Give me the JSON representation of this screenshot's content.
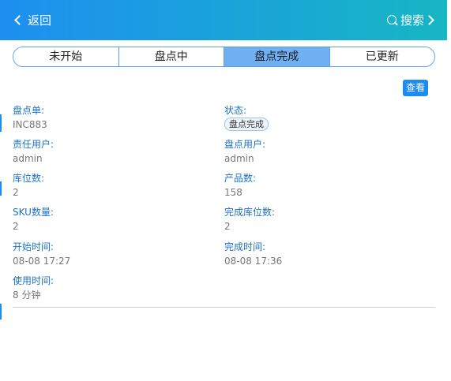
{
  "header": {
    "back_label": "返回",
    "search_label": "搜索"
  },
  "tabs": [
    {
      "label": "未开始",
      "active": false
    },
    {
      "label": "盘点中",
      "active": false
    },
    {
      "label": "盘点完成",
      "active": true
    },
    {
      "label": "已更新",
      "active": false
    }
  ],
  "view_button": "查看",
  "fields": {
    "order": {
      "label": "盘点单:",
      "value": "INC883"
    },
    "status": {
      "label": "状态:",
      "value": "盘点完成"
    },
    "owner": {
      "label": "责任用户:",
      "value": "admin"
    },
    "counter": {
      "label": "盘点用户:",
      "value": "admin"
    },
    "locations": {
      "label": "库位数:",
      "value": "2"
    },
    "products": {
      "label": "产品数:",
      "value": "158"
    },
    "sku": {
      "label": "SKU数量:",
      "value": "2"
    },
    "done_locs": {
      "label": "完成库位数:",
      "value": "2"
    },
    "start_time": {
      "label": "开始时间:",
      "value": "08-08 17:27"
    },
    "finish_time": {
      "label": "完成时间:",
      "value": "08-08 17:36"
    },
    "duration": {
      "label": "使用时间:",
      "value": "8 分钟"
    }
  },
  "colors": {
    "header_start": "#1d8ff0",
    "header_end": "#17b6c4",
    "active_tab": "#6fb0f2",
    "label": "#1c72c8",
    "button": "#1c8cf0"
  }
}
